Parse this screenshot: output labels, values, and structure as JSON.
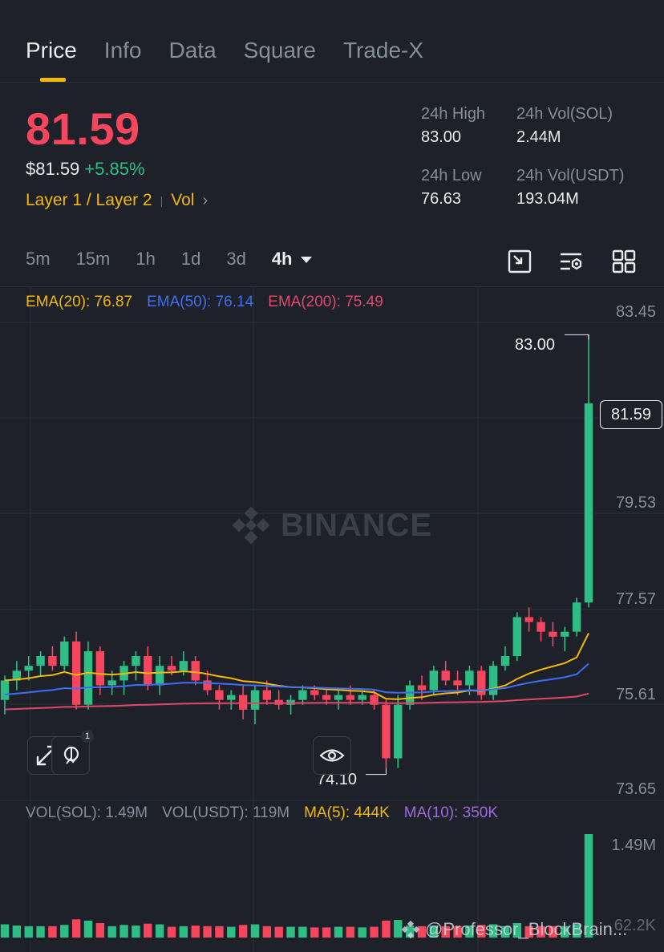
{
  "tabs": [
    {
      "label": "Price",
      "active": true
    },
    {
      "label": "Info"
    },
    {
      "label": "Data"
    },
    {
      "label": "Square"
    },
    {
      "label": "Trade-X"
    }
  ],
  "ticker": {
    "last_price": "81.59",
    "usd_price": "$81.59",
    "change": "+5.85%",
    "tag_layer": "Layer 1 / Layer 2",
    "tag_vol": "Vol",
    "stats": [
      {
        "label": "24h High",
        "value": "83.00"
      },
      {
        "label": "24h Vol(SOL)",
        "value": "2.44M"
      },
      {
        "label": "24h Low",
        "value": "76.63"
      },
      {
        "label": "24h Vol(USDT)",
        "value": "193.04M"
      }
    ]
  },
  "intervals": [
    "5m",
    "15m",
    "1h",
    "1d",
    "3d",
    "4h"
  ],
  "active_interval": "4h",
  "tools": [
    "fullscreen-chart-icon",
    "indicator-settings-icon",
    "grid-layout-icon"
  ],
  "chart": {
    "ema_legend": [
      {
        "text": "EMA(20): 76.87",
        "color": "#f0b90b"
      },
      {
        "text": "EMA(50): 76.14",
        "color": "#3c6ff2"
      },
      {
        "text": "EMA(200): 75.49",
        "color": "#e0476a"
      }
    ],
    "y_axis": [
      "83.45",
      "79.53",
      "77.57",
      "75.61",
      "73.65"
    ],
    "current_price_tag": "81.59",
    "high_marker": "83.00",
    "low_marker": "74.10",
    "watermark": "BINANCE",
    "badge_count": "1"
  },
  "volume": {
    "legend": [
      {
        "text": "VOL(SOL): 1.49M",
        "color": "#848e9c"
      },
      {
        "text": "VOL(USDT): 119M",
        "color": "#848e9c"
      },
      {
        "text": "MA(5): 444K",
        "color": "#f0b90b"
      },
      {
        "text": "MA(10): 350K",
        "color": "#9c6ade"
      }
    ],
    "y_axis": [
      "1.49M",
      "62.2K"
    ]
  },
  "credit": "@Professor_BlockBrain...",
  "colors": {
    "up": "#2ebd85",
    "down": "#f6465d",
    "accent": "#f0b90b",
    "bg": "#1e2129",
    "grid": "#2b2f36"
  },
  "chart_data": {
    "type": "candlestick",
    "y_range": [
      73.65,
      83.45
    ],
    "ema20_last": 76.87,
    "ema50_last": 76.14,
    "ema200_last": 75.49,
    "high": 83.0,
    "low": 74.1,
    "last": 81.59,
    "candles": [
      [
        75.5,
        76.0,
        75.2,
        75.9
      ],
      [
        75.9,
        76.3,
        75.7,
        76.1
      ],
      [
        76.1,
        76.4,
        75.9,
        76.2
      ],
      [
        76.2,
        76.5,
        76.0,
        76.4
      ],
      [
        76.4,
        76.6,
        76.1,
        76.2
      ],
      [
        76.2,
        76.8,
        76.1,
        76.7
      ],
      [
        76.7,
        76.9,
        75.3,
        75.4
      ],
      [
        75.4,
        76.7,
        75.3,
        76.5
      ],
      [
        76.5,
        76.6,
        75.6,
        75.8
      ],
      [
        75.8,
        76.1,
        75.6,
        75.9
      ],
      [
        75.9,
        76.3,
        75.6,
        76.2
      ],
      [
        76.2,
        76.5,
        75.9,
        76.4
      ],
      [
        76.4,
        76.6,
        75.7,
        75.8
      ],
      [
        75.8,
        76.4,
        75.6,
        76.2
      ],
      [
        76.2,
        76.4,
        76.0,
        76.1
      ],
      [
        76.1,
        76.5,
        76.0,
        76.3
      ],
      [
        76.3,
        76.4,
        75.8,
        75.9
      ],
      [
        75.9,
        76.1,
        75.6,
        75.7
      ],
      [
        75.7,
        75.8,
        75.3,
        75.5
      ],
      [
        75.5,
        75.7,
        75.3,
        75.6
      ],
      [
        75.6,
        75.8,
        75.1,
        75.3
      ],
      [
        75.3,
        75.8,
        75.0,
        75.7
      ],
      [
        75.7,
        75.9,
        75.4,
        75.5
      ],
      [
        75.5,
        75.7,
        75.3,
        75.4
      ],
      [
        75.4,
        75.6,
        75.2,
        75.5
      ],
      [
        75.5,
        75.8,
        75.4,
        75.7
      ],
      [
        75.7,
        75.8,
        75.5,
        75.6
      ],
      [
        75.6,
        75.7,
        75.4,
        75.5
      ],
      [
        75.5,
        75.7,
        75.3,
        75.6
      ],
      [
        75.6,
        75.8,
        75.4,
        75.5
      ],
      [
        75.5,
        75.7,
        75.4,
        75.6
      ],
      [
        75.6,
        75.7,
        75.3,
        75.4
      ],
      [
        75.4,
        75.5,
        74.1,
        74.3
      ],
      [
        74.3,
        75.6,
        74.1,
        75.4
      ],
      [
        75.4,
        75.9,
        75.3,
        75.8
      ],
      [
        75.8,
        76.0,
        75.5,
        75.7
      ],
      [
        75.7,
        76.2,
        75.6,
        76.1
      ],
      [
        76.1,
        76.3,
        75.8,
        75.9
      ],
      [
        75.9,
        76.1,
        75.6,
        75.8
      ],
      [
        75.8,
        76.2,
        75.6,
        76.1
      ],
      [
        76.1,
        76.2,
        75.5,
        75.6
      ],
      [
        75.6,
        76.3,
        75.5,
        76.2
      ],
      [
        76.2,
        76.6,
        76.1,
        76.4
      ],
      [
        76.4,
        77.3,
        76.3,
        77.2
      ],
      [
        77.2,
        77.4,
        76.9,
        77.1
      ],
      [
        77.1,
        77.2,
        76.7,
        76.9
      ],
      [
        76.9,
        77.1,
        76.6,
        76.8
      ],
      [
        76.8,
        77.0,
        76.5,
        76.9
      ],
      [
        76.9,
        77.6,
        76.8,
        77.5
      ],
      [
        77.5,
        83.0,
        77.4,
        81.59
      ]
    ]
  }
}
